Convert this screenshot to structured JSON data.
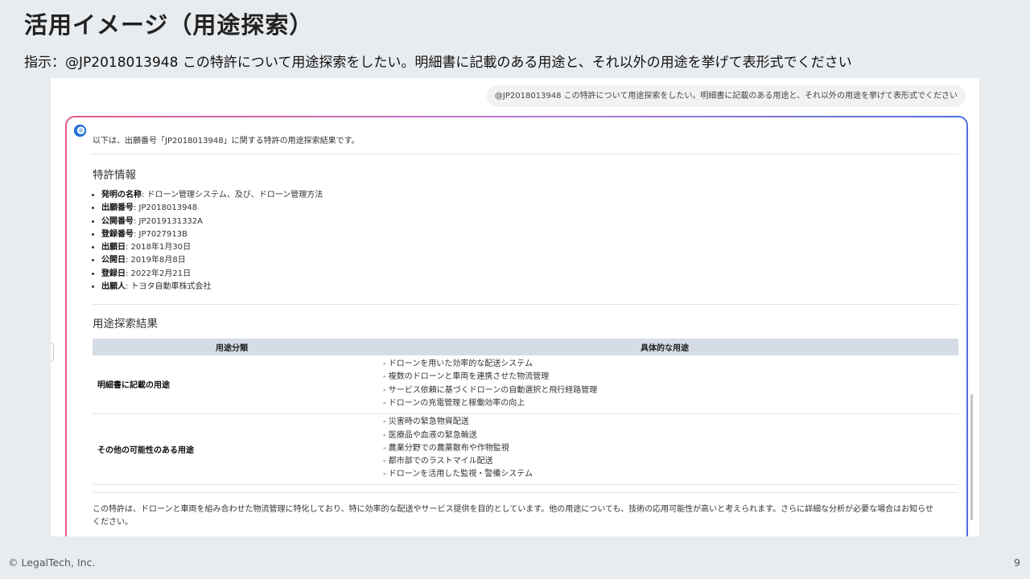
{
  "slide": {
    "title": "活用イメージ（用途探索）",
    "instruction": "指示：@JP2018013948 この特許について用途探索をしたい。明細書に記載のある用途と、それ以外の用途を挙げて表形式でください",
    "copyright": "© LegalTech, Inc.",
    "page_number": "9"
  },
  "chat": {
    "user_prompt": "@JP2018013948 この特許について用途探索をしたい。明細書に記載のある用途と、それ以外の用途を挙げて表形式でください",
    "intro": "以下は、出願番号「JP2018013948」に関する特許の用途探索結果です。",
    "patent_info": {
      "heading": "特許情報",
      "items": [
        {
          "label": "発明の名称",
          "value": ": ドローン管理システム、及び、ドローン管理方法"
        },
        {
          "label": "出願番号",
          "value": ": JP2018013948"
        },
        {
          "label": "公開番号",
          "value": ": JP2019131332A"
        },
        {
          "label": "登録番号",
          "value": ": JP7027913B"
        },
        {
          "label": "出願日",
          "value": ": 2018年1月30日"
        },
        {
          "label": "公開日",
          "value": ": 2019年8月8日"
        },
        {
          "label": "登録日",
          "value": ": 2022年2月21日"
        },
        {
          "label": "出願人",
          "value": ": トヨタ自動車株式会社"
        }
      ]
    },
    "results": {
      "heading": "用途探索結果",
      "columns": [
        "用途分類",
        "具体的な用途"
      ],
      "rows": [
        {
          "category": "明細書に記載の用途",
          "uses": [
            "- ドローンを用いた効率的な配送システム",
            "- 複数のドローンと車両を連携させた物流管理",
            "- サービス依頼に基づくドローンの自動選択と飛行経路管理",
            "- ドローンの充電管理と稼働効率の向上"
          ]
        },
        {
          "category": "その他の可能性のある用途",
          "uses": [
            "- 災害時の緊急物資配送",
            "- 医療品や血液の緊急輸送",
            "- 農業分野での農薬散布や作物監視",
            "- 都市部でのラストマイル配送",
            "- ドローンを活用した監視・警備システム"
          ]
        }
      ]
    },
    "conclusion": "この特許は、ドローンと車両を組み合わせた物流管理に特化しており、特に効率的な配送やサービス提供を目的としています。他の用途についても、技術の応用可能性が高いと考えられます。さらに詳細な分析が必要な場合はお知らせください。"
  },
  "colors": {
    "slide_background": "#e9ecef",
    "table_header": "#d5dce5",
    "card_border_start": "#e35a8a",
    "card_border_end": "#4f6fe0",
    "logo_blue": "#1f6fd6"
  },
  "icons": {
    "assistant": "assistant-logo-icon"
  }
}
